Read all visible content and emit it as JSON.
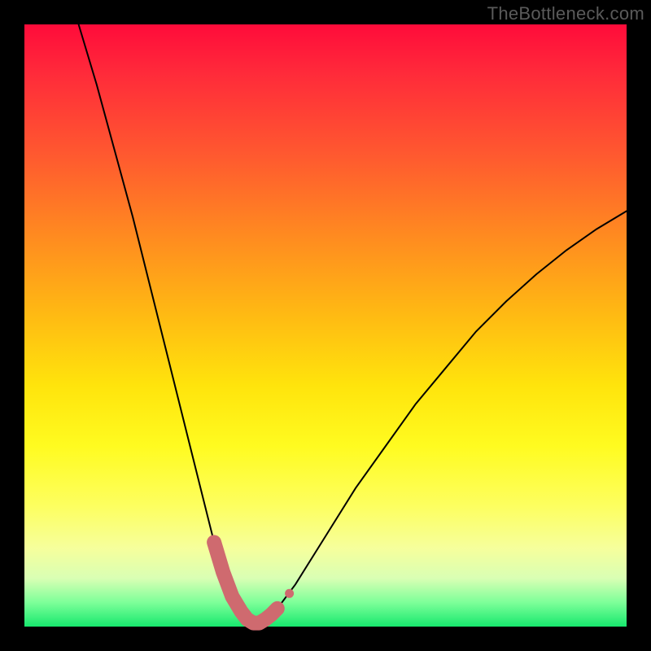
{
  "watermark": "TheBottleneck.com",
  "chart_data": {
    "type": "line",
    "title": "",
    "xlabel": "",
    "ylabel": "",
    "xlim": [
      0,
      100
    ],
    "ylim": [
      0,
      100
    ],
    "grid": false,
    "series": [
      {
        "name": "bottleneck-curve",
        "x": [
          9,
          12,
          15,
          18,
          21,
          24,
          27,
          30,
          31.5,
          33,
          34.5,
          36,
          37,
          38,
          39,
          40,
          42,
          45,
          50,
          55,
          60,
          65,
          70,
          75,
          80,
          85,
          90,
          95,
          100
        ],
        "y": [
          100,
          90,
          79,
          68,
          56,
          44,
          32,
          20,
          14,
          9,
          5,
          2.5,
          1.2,
          0.6,
          0.6,
          1.2,
          3,
          7,
          15,
          23,
          30,
          37,
          43,
          49,
          54,
          58.5,
          62.5,
          66,
          69
        ]
      }
    ],
    "marker_band": {
      "name": "optimal-range",
      "x": [
        31.5,
        33,
        34.5,
        36,
        37,
        38,
        39,
        40,
        41,
        42
      ],
      "y": [
        14,
        9,
        5,
        2.5,
        1.2,
        0.6,
        0.6,
        1.2,
        2,
        3
      ]
    },
    "extra_marker": {
      "x": 44,
      "y": 5.5
    },
    "colors": {
      "curve": "#000000",
      "marker": "#cf6a6f",
      "gradient_top": "#ff0b3a",
      "gradient_bottom": "#17e86e"
    }
  }
}
